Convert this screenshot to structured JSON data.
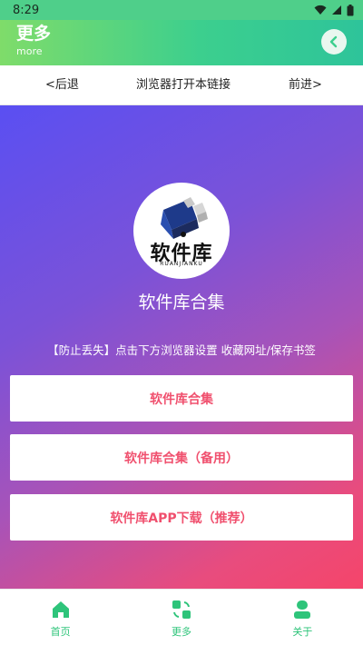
{
  "status_bar": {
    "time": "8:29"
  },
  "header": {
    "title": "更多",
    "subtitle": "more"
  },
  "nav": {
    "back": "<后退",
    "open_browser": "浏览器打开本链接",
    "forward": "前进>"
  },
  "logo": {
    "text": "软件库",
    "subtext": "RUANJIANKU"
  },
  "hero": {
    "title": "软件库合集",
    "notice": "【防止丢失】点击下方浏览器设置 收藏网址/保存书签"
  },
  "buttons": [
    {
      "label": "软件库合集"
    },
    {
      "label": "软件库合集（备用）"
    },
    {
      "label": "软件库APP下载（推荐）"
    }
  ],
  "tabs": [
    {
      "label": "首页",
      "icon": "home-icon"
    },
    {
      "label": "更多",
      "icon": "more-icon"
    },
    {
      "label": "关于",
      "icon": "user-icon"
    }
  ],
  "colors": {
    "accent_green": "#2ec47a",
    "button_text": "#f0506e",
    "gradient_start": "#5a4ff2",
    "gradient_end": "#f5456a"
  }
}
